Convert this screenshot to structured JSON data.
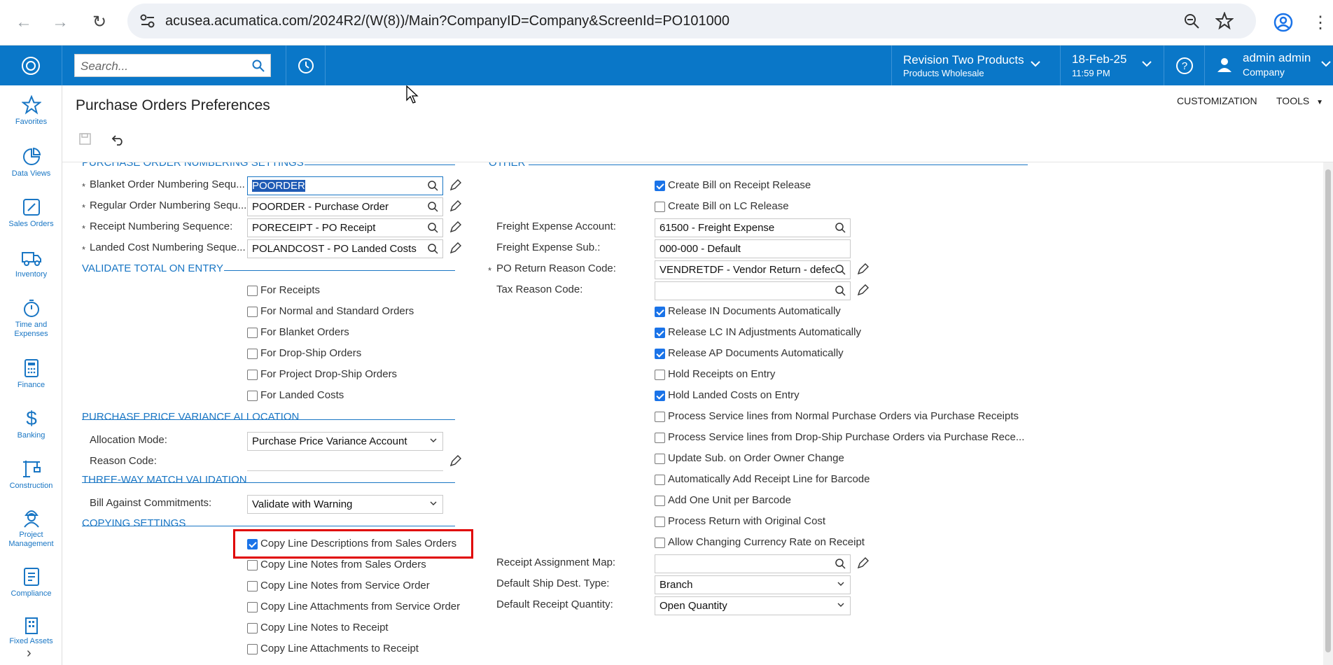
{
  "browser": {
    "url": "acusea.acumatica.com/2024R2/(W(8))/Main?CompanyID=Company&ScreenId=PO101000"
  },
  "topbar": {
    "search_placeholder": "Search...",
    "company_name": "Revision Two Products",
    "company_branch": "Products Wholesale",
    "date": "18-Feb-25",
    "time": "11:59 PM",
    "user_name": "admin admin",
    "user_company": "Company"
  },
  "leftnav": {
    "items": [
      {
        "label": "Favorites",
        "icon": "star-icon"
      },
      {
        "label": "Data Views",
        "icon": "pie-chart-icon"
      },
      {
        "label": "Sales Orders",
        "icon": "edit-icon"
      },
      {
        "label": "Inventory",
        "icon": "truck-icon"
      },
      {
        "label": "Time and Expenses",
        "icon": "stopwatch-icon"
      },
      {
        "label": "Finance",
        "icon": "calculator-icon"
      },
      {
        "label": "Banking",
        "icon": "dollar-icon"
      },
      {
        "label": "Construction",
        "icon": "crane-icon"
      },
      {
        "label": "Project Management",
        "icon": "worker-icon"
      },
      {
        "label": "Compliance",
        "icon": "checklist-icon"
      },
      {
        "label": "Fixed Assets",
        "icon": "building-icon"
      }
    ]
  },
  "page": {
    "title": "Purchase Orders Preferences",
    "customization": "CUSTOMIZATION",
    "tools": "TOOLS"
  },
  "sections": {
    "numbering": "PURCHASE ORDER NUMBERING SETTINGS",
    "validate": "VALIDATE TOTAL ON ENTRY",
    "ppv": "PURCHASE PRICE VARIANCE ALLOCATION",
    "threeway": "THREE-WAY MATCH VALIDATION",
    "copying": "COPYING SETTINGS",
    "other": "OTHER"
  },
  "numbering": {
    "blanket_label": "Blanket Order Numbering Sequ...",
    "blanket_value": "POORDER",
    "regular_label": "Regular Order Numbering Sequ...",
    "regular_value": "POORDER - Purchase Order",
    "receipt_label": "Receipt Numbering Sequence:",
    "receipt_value": "PORECEIPT - PO Receipt",
    "landed_label": "Landed Cost Numbering Seque...",
    "landed_value": "POLANDCOST - PO Landed Costs"
  },
  "validate": {
    "items": [
      {
        "label": "For Receipts",
        "checked": false
      },
      {
        "label": "For Normal and Standard Orders",
        "checked": false
      },
      {
        "label": "For Blanket Orders",
        "checked": false
      },
      {
        "label": "For Drop-Ship Orders",
        "checked": false
      },
      {
        "label": "For Project Drop-Ship Orders",
        "checked": false
      },
      {
        "label": "For Landed Costs",
        "checked": false
      }
    ]
  },
  "ppv": {
    "mode_label": "Allocation Mode:",
    "mode_value": "Purchase Price Variance Account",
    "reason_label": "Reason Code:",
    "reason_value": ""
  },
  "threeway": {
    "bill_label": "Bill Against Commitments:",
    "bill_value": "Validate with Warning"
  },
  "copying": {
    "items": [
      {
        "label": "Copy Line Descriptions from Sales Orders",
        "checked": true
      },
      {
        "label": "Copy Line Notes from Sales Orders",
        "checked": false
      },
      {
        "label": "Copy Line Notes from Service Order",
        "checked": false
      },
      {
        "label": "Copy Line Attachments from Service Order",
        "checked": false
      },
      {
        "label": "Copy Line Notes to Receipt",
        "checked": false
      },
      {
        "label": "Copy Line Attachments to Receipt",
        "checked": false
      }
    ]
  },
  "other": {
    "create_bill_receipt": {
      "label": "Create Bill on Receipt Release",
      "checked": true
    },
    "create_bill_lc": {
      "label": "Create Bill on LC Release",
      "checked": false
    },
    "freight_account_label": "Freight Expense Account:",
    "freight_account_value": "61500 - Freight Expense",
    "freight_sub_label": "Freight Expense Sub.:",
    "freight_sub_value": "000-000 - Default",
    "return_reason_label": "PO Return Reason Code:",
    "return_reason_value": "VENDRETDF - Vendor Return - defect",
    "tax_reason_label": "Tax Reason Code:",
    "tax_reason_value": "",
    "checks": [
      {
        "label": "Release IN Documents Automatically",
        "checked": true
      },
      {
        "label": "Release LC IN Adjustments Automatically",
        "checked": true
      },
      {
        "label": "Release AP Documents Automatically",
        "checked": true
      },
      {
        "label": "Hold Receipts on Entry",
        "checked": false
      },
      {
        "label": "Hold Landed Costs on Entry",
        "checked": true
      },
      {
        "label": "Process Service lines from Normal Purchase Orders via Purchase Receipts",
        "checked": false
      },
      {
        "label": "Process Service lines from Drop-Ship Purchase Orders via Purchase Rece...",
        "checked": false
      },
      {
        "label": "Update Sub. on Order Owner Change",
        "checked": false
      },
      {
        "label": "Automatically Add Receipt Line for Barcode",
        "checked": false
      },
      {
        "label": "Add One Unit per Barcode",
        "checked": false
      },
      {
        "label": "Process Return with Original Cost",
        "checked": false
      },
      {
        "label": "Allow Changing Currency Rate on Receipt",
        "checked": false
      }
    ],
    "assign_map_label": "Receipt Assignment Map:",
    "assign_map_value": "",
    "ship_dest_label": "Default Ship Dest. Type:",
    "ship_dest_value": "Branch",
    "receipt_qty_label": "Default Receipt Quantity:",
    "receipt_qty_value": "Open Quantity"
  },
  "colors": {
    "brand": "#0a77c8",
    "accent": "#1976c4",
    "highlight_box": "#e00000",
    "checkbox": "#1a73e8"
  }
}
